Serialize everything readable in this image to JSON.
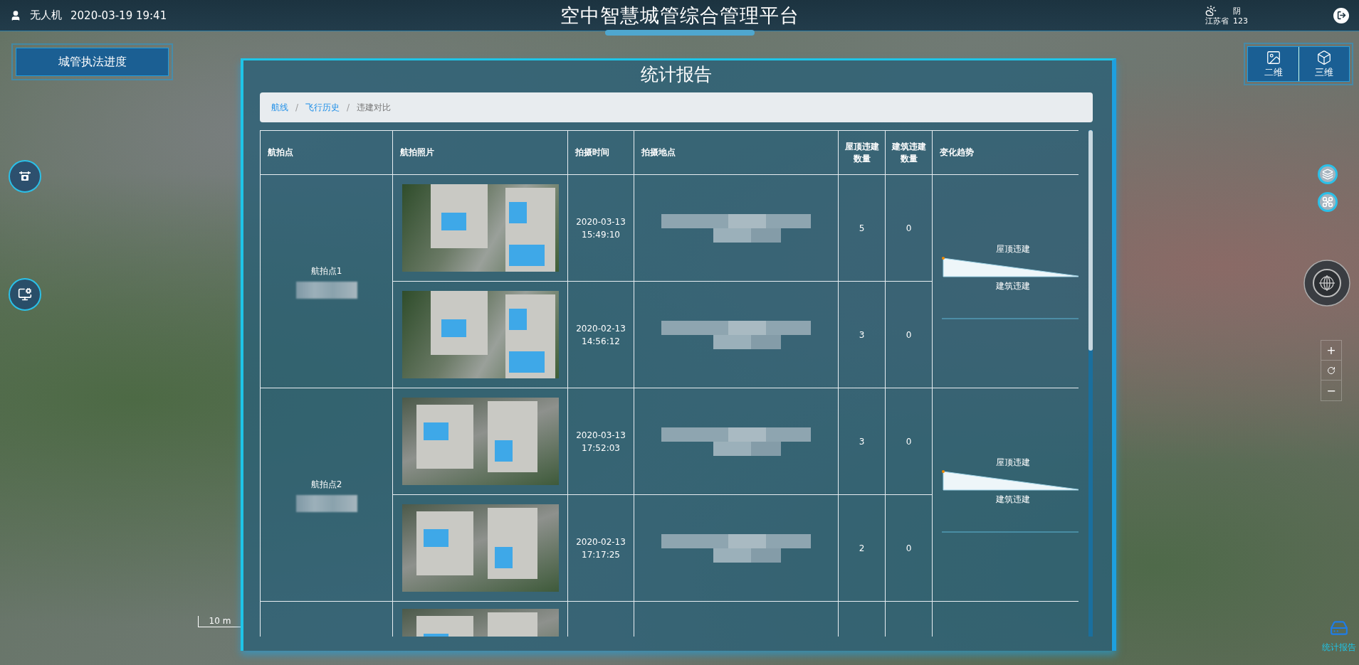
{
  "header": {
    "user": "无人机",
    "datetime": "2020-03-19 19:41",
    "title": "空中智慧城管综合管理平台",
    "weather": {
      "condition": "阴",
      "province": "江苏省",
      "value": "123"
    }
  },
  "left_button": "城管执法进度",
  "view_toggle": [
    {
      "label": "二维",
      "kind": "flat"
    },
    {
      "label": "三维",
      "kind": "solid"
    }
  ],
  "zoom_controls": {
    "zoom_in": "+",
    "zoom_out": "−"
  },
  "scale": "10 m",
  "report_button": "统计报告",
  "dialog": {
    "title": "统计报告",
    "breadcrumb": [
      {
        "label": "航线",
        "link": true,
        "separator": "/"
      },
      {
        "label": "飞行历史",
        "link": true,
        "separator": "/"
      },
      {
        "label": "违建对比",
        "link": false
      }
    ],
    "table": {
      "columns": [
        "航拍点",
        "航拍照片",
        "拍摄时间",
        "拍摄地点",
        "屋顶违建数量",
        "建筑违建数量",
        "变化趋势"
      ],
      "groups": [
        {
          "name": "航拍点1",
          "trend": [
            "屋顶违建",
            "建筑违建"
          ],
          "rows": [
            {
              "kind": "photo",
              "time": "2020-03-13 15:49:10",
              "roof": "5",
              "building": "0"
            },
            {
              "kind": "photo",
              "time": "2020-02-13 14:56:12",
              "roof": "3",
              "building": "0"
            }
          ]
        },
        {
          "name": "航拍点2",
          "trend": [
            "屋顶违建",
            "建筑违建"
          ],
          "rows": [
            {
              "kind": "photo",
              "time": "2020-03-13 17:52:03",
              "roof": "3",
              "building": "0"
            },
            {
              "kind": "photo",
              "time": "2020-02-13 17:17:25",
              "roof": "2",
              "building": "0"
            }
          ]
        },
        {
          "rows": [
            {
              "kind": "photo"
            }
          ]
        }
      ]
    }
  }
}
